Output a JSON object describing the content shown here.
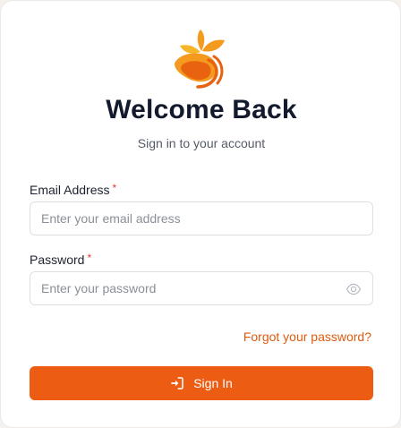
{
  "brand": {
    "logo_icon": "orange-fruit-leaf-logo",
    "accent_color": "#ec5c12",
    "logo_colors": [
      "#f39a1f",
      "#e8620f",
      "#f6b62a"
    ]
  },
  "header": {
    "title": "Welcome Back",
    "subtitle": "Sign in to your account"
  },
  "form": {
    "email": {
      "label": "Email Address",
      "required_mark": "*",
      "placeholder": "Enter your email address",
      "value": ""
    },
    "password": {
      "label": "Password",
      "required_mark": "*",
      "placeholder": "Enter your password",
      "value": "",
      "toggle_icon": "eye-icon"
    },
    "forgot_link": "Forgot your password?",
    "submit": {
      "label": "Sign In",
      "icon": "sign-in-icon"
    }
  }
}
